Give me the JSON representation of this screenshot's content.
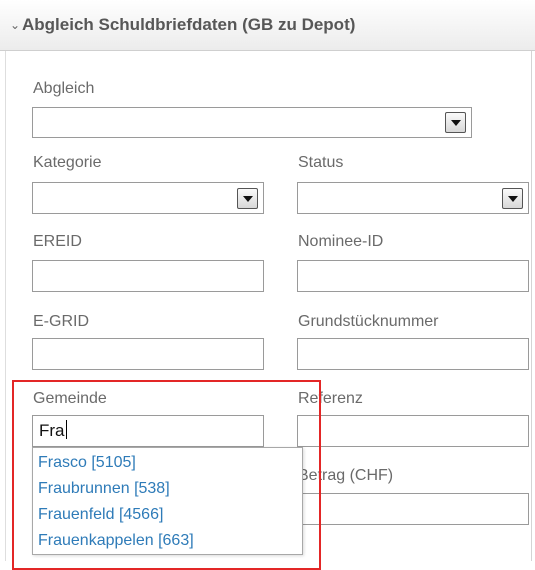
{
  "header": {
    "title": "Abgleich Schuldbriefdaten (GB zu Depot)",
    "chevron_icon": "chevron-down-icon"
  },
  "form": {
    "abgleich": {
      "label": "Abgleich",
      "value": ""
    },
    "kategorie": {
      "label": "Kategorie",
      "value": ""
    },
    "status": {
      "label": "Status",
      "value": ""
    },
    "ereid": {
      "label": "EREID",
      "value": ""
    },
    "nominee_id": {
      "label": "Nominee-ID",
      "value": ""
    },
    "egrid": {
      "label": "E-GRID",
      "value": ""
    },
    "grundstuecknummer": {
      "label": "Grundstücknummer",
      "value": ""
    },
    "gemeinde": {
      "label": "Gemeinde",
      "value": "Fra"
    },
    "referenz": {
      "label": "Referenz",
      "value": ""
    },
    "betrag": {
      "label": "Betrag (CHF)",
      "value": ""
    }
  },
  "suggestions": [
    "Frasco [5105]",
    "Fraubrunnen [538]",
    "Frauenfeld [4566]",
    "Frauenkappelen [663]"
  ],
  "colors": {
    "highlight": "#e32626",
    "suggestion_link": "#2e7bb8"
  }
}
